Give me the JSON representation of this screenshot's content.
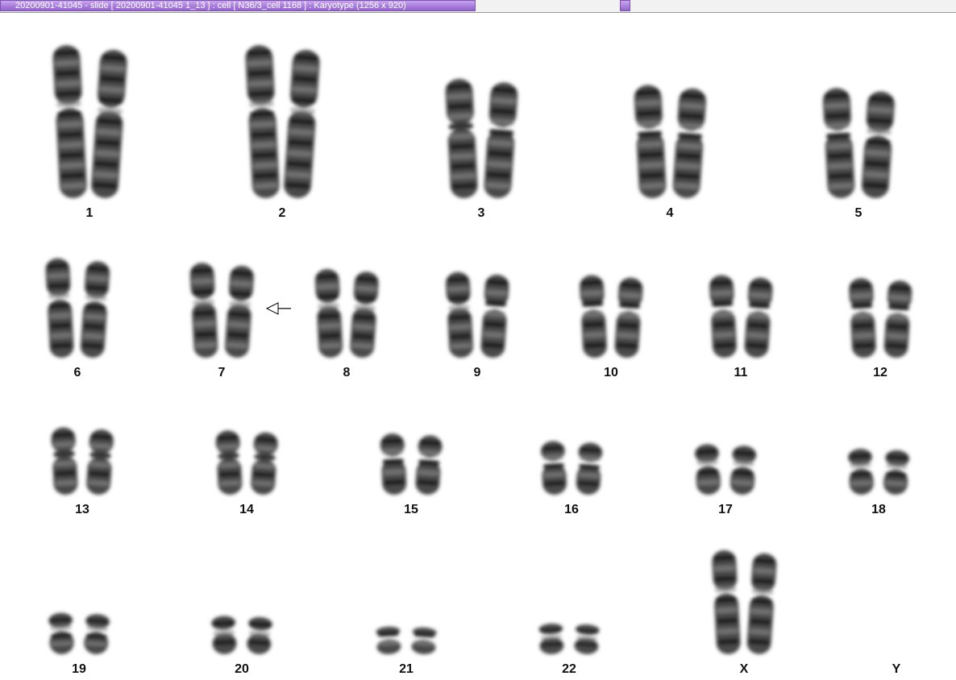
{
  "window": {
    "title": "20200901-41045 - slide [ 20200901-41045 1_13 ] : cell [ N36/3_cell 1168 ] : Karyotype  (1256 x 920)"
  },
  "karyotype": {
    "colors": {
      "chromosome": "#2b2b2b",
      "label": "#111111",
      "background": "#ffffff"
    },
    "annotation_icon": "arrow-left-outline-icon",
    "rows": [
      {
        "pairs": [
          {
            "label": "1",
            "size": 1.0
          },
          {
            "label": "2",
            "size": 1.0
          },
          {
            "label": "3",
            "size": 0.78
          },
          {
            "label": "4",
            "size": 0.74
          },
          {
            "label": "5",
            "size": 0.72
          }
        ]
      },
      {
        "pairs": [
          {
            "label": "6",
            "size": 0.65
          },
          {
            "label": "7",
            "size": 0.62,
            "marked": true
          },
          {
            "label": "8",
            "size": 0.58
          },
          {
            "label": "9",
            "size": 0.56
          },
          {
            "label": "10",
            "size": 0.54
          },
          {
            "label": "11",
            "size": 0.54
          },
          {
            "label": "12",
            "size": 0.52
          }
        ]
      },
      {
        "pairs": [
          {
            "label": "13",
            "size": 0.44
          },
          {
            "label": "14",
            "size": 0.42
          },
          {
            "label": "15",
            "size": 0.4
          },
          {
            "label": "16",
            "size": 0.35
          },
          {
            "label": "17",
            "size": 0.33
          },
          {
            "label": "18",
            "size": 0.3
          }
        ]
      },
      {
        "pairs": [
          {
            "label": "19",
            "size": 0.27
          },
          {
            "label": "20",
            "size": 0.25
          },
          {
            "label": "21",
            "size": 0.18
          },
          {
            "label": "22",
            "size": 0.2
          },
          {
            "label": "X",
            "size": 0.68
          },
          {
            "label": "Y",
            "size": 0
          }
        ]
      }
    ]
  }
}
